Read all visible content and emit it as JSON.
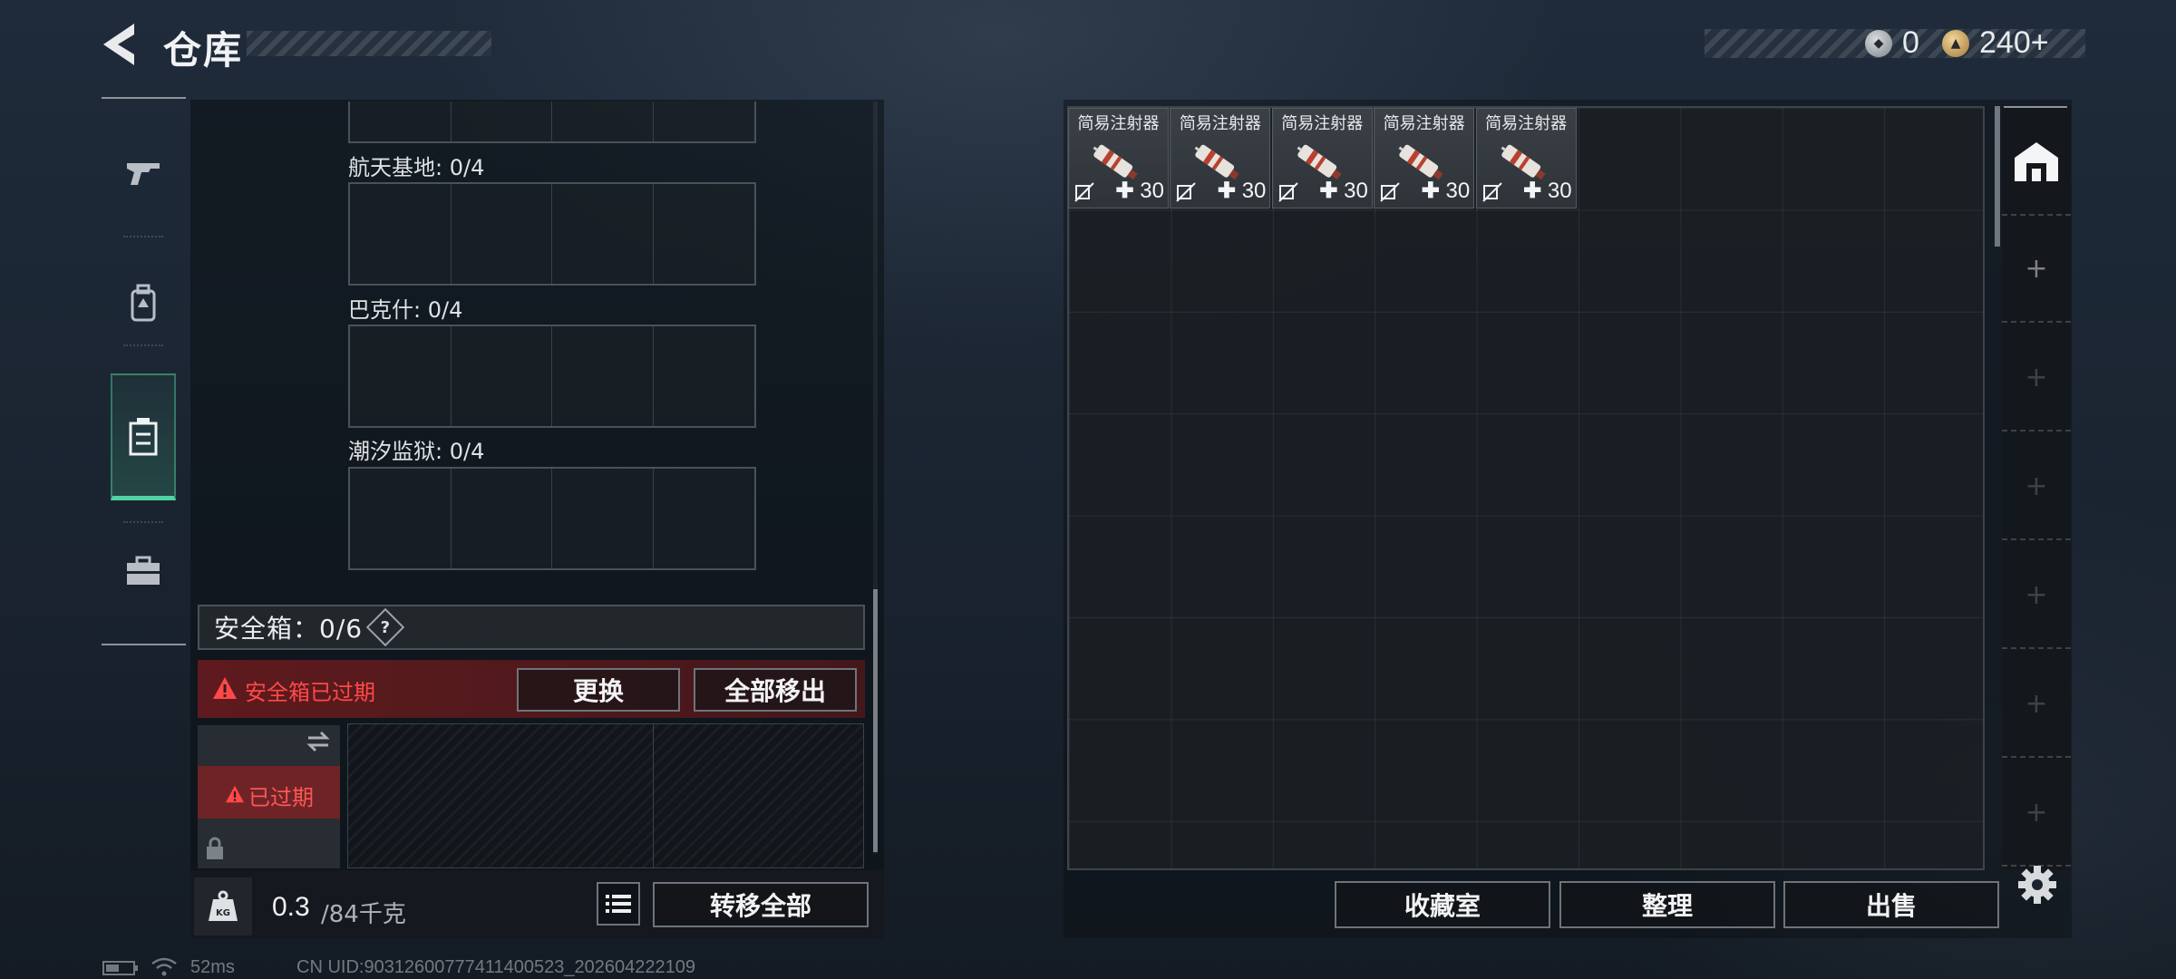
{
  "header": {
    "title": "仓库",
    "silver_value": "0",
    "gold_value": "240+"
  },
  "colors": {
    "accent_green": "#4fd3a2",
    "warning_red": "#ff4848",
    "panel_bg": "#1c2025"
  },
  "tabs": [
    {
      "name": "weapons",
      "icon": "pistol-icon"
    },
    {
      "name": "gear",
      "icon": "backpack-icon"
    },
    {
      "name": "containers",
      "icon": "case-icon",
      "active": true
    },
    {
      "name": "tools",
      "icon": "toolbox-icon"
    }
  ],
  "map_stashes": [
    {
      "label": "航天基地: 0/4"
    },
    {
      "label": "巴克什: 0/4"
    },
    {
      "label": "潮汐监狱: 0/4"
    }
  ],
  "safebox": {
    "title": "安全箱：0/6",
    "help": "?",
    "expired_notice": "安全箱已过期",
    "replace_label": "更换",
    "remove_all_label": "全部移出",
    "item_status": "已过期"
  },
  "weight": {
    "current": "0.3",
    "max": "/84千克",
    "icon_text": "KG"
  },
  "transfer_all_label": "转移全部",
  "stash": {
    "items": [
      {
        "name": "简易注射器",
        "heal": "30"
      },
      {
        "name": "简易注射器",
        "heal": "30"
      },
      {
        "name": "简易注射器",
        "heal": "30"
      },
      {
        "name": "简易注射器",
        "heal": "30"
      },
      {
        "name": "简易注射器",
        "heal": "30"
      }
    ],
    "side_slots": [
      "+",
      "+",
      "+",
      "+",
      "+",
      "+"
    ]
  },
  "bottom_buttons": {
    "vault": "收藏室",
    "sort": "整理",
    "sell": "出售"
  },
  "status": {
    "ping": "52ms",
    "uid": "CN UID:90312600777411400523_202604222109"
  }
}
